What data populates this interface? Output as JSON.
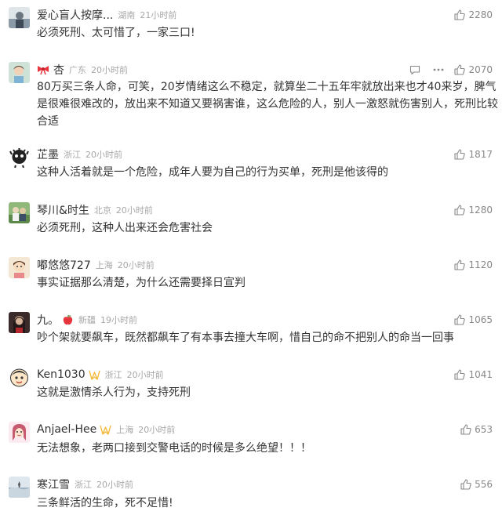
{
  "comments": [
    {
      "username": "爱心盲人按摩...",
      "location": "湖南",
      "time": "21小时前",
      "text": "必须死刑、太可惜了，一家三口!",
      "likes": "2280"
    },
    {
      "username": "杏",
      "location": "广东",
      "time": "20小时前",
      "text_lines": [
        "80万买三条人命，可笑，20岁情绪这么不稳定，就算坐二十五年牢就放出来也才40来岁，脾气",
        "是很难很难改的，放出来不知道又要祸害谁，这么危险的人，别人一激怒就伤害别人，死刑比较",
        "合适"
      ],
      "likes": "2070"
    },
    {
      "username": "芷墨",
      "location": "浙江",
      "time": "20小时前",
      "text": "这种人活着就是一个危险，成年人要为自己的行为买单，死刑是他该得的",
      "likes": "1817"
    },
    {
      "username": "琴川&时生",
      "location": "北京",
      "time": "20小时前",
      "text": "必须死刑，这种人出来还会危害社会",
      "likes": "1280"
    },
    {
      "username": "嘟悠悠727",
      "location": "上海",
      "time": "20小时前",
      "text": "事实证据那么清楚，为什么还需要择日宣判",
      "likes": "1120"
    },
    {
      "username": "九。",
      "location": "新疆",
      "time": "19小时前",
      "text": "吵个架就要飙车，既然都飙车了有本事去撞大车啊，惜自己的命不把别人的命当一回事",
      "likes": "1065"
    },
    {
      "username": "Ken1030",
      "location": "浙江",
      "time": "20小时前",
      "text": "这就是激情杀人行为，支持死刑",
      "likes": "1041"
    },
    {
      "username": "Anjael-Hee",
      "location": "上海",
      "time": "20小时前",
      "text": "无法想象，老两口接到交警电话的时候是多么绝望！！！",
      "likes": "653"
    },
    {
      "username": "寒江雪",
      "location": "浙江",
      "time": "20小时前",
      "text": "三条鲜活的生命，死不足惜!",
      "likes": "556"
    }
  ],
  "colors": {
    "text": "#333333",
    "meta": "#a7a7a7",
    "likes": "#888888",
    "badge_gold": "#f5b83b",
    "badge_red": "#e8343c"
  }
}
